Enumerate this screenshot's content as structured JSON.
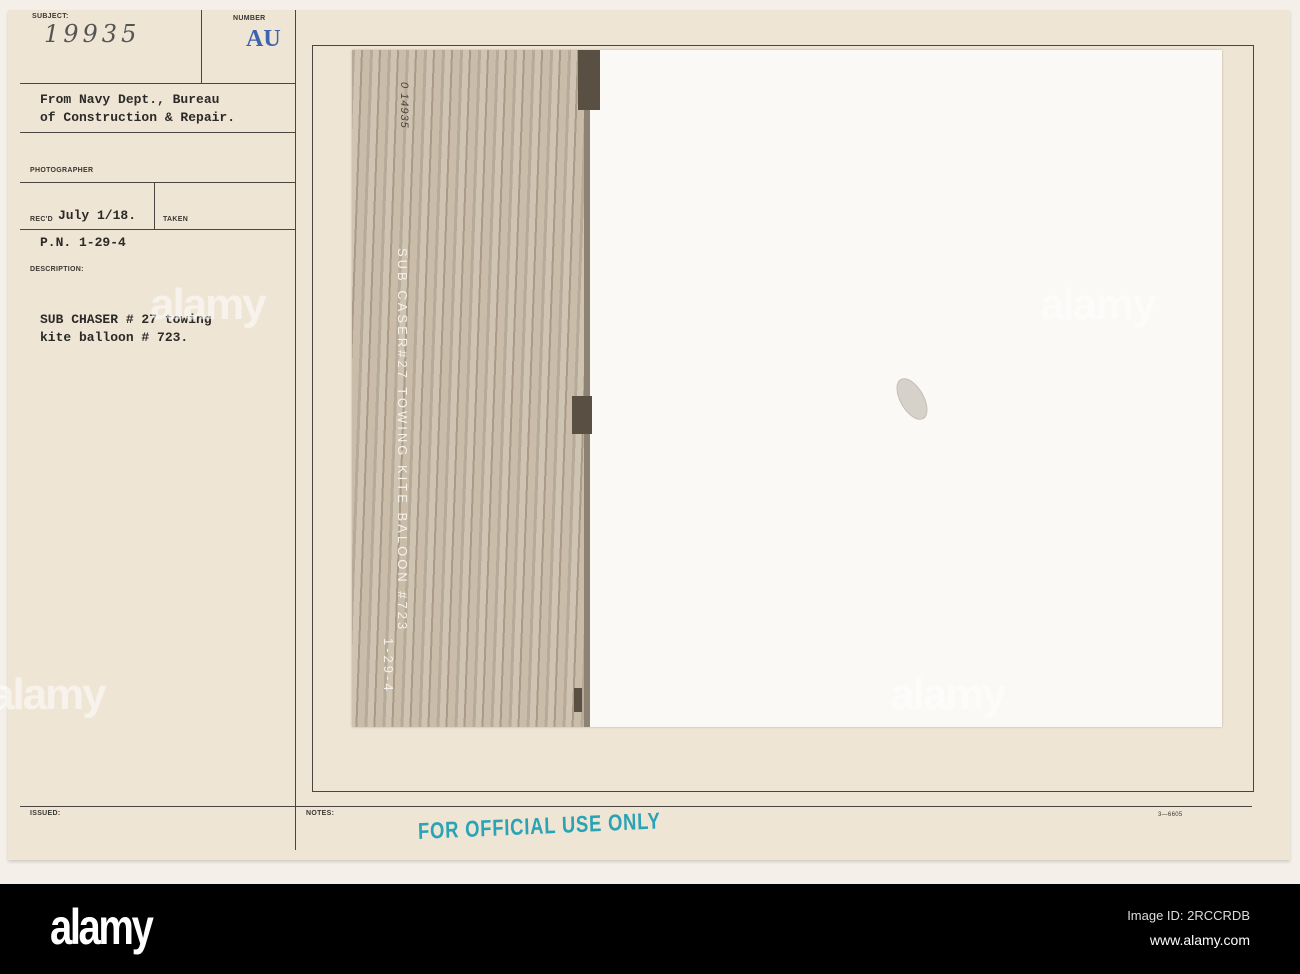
{
  "card": {
    "subject_label": "SUBJECT:",
    "subject_value": "19935",
    "number_label": "NUMBER",
    "number_value": "AU",
    "source_line1": "From Navy Dept., Bureau",
    "source_line2": "of Construction & Repair.",
    "photographer_label": "PHOTOGRAPHER",
    "recd_label": "REC'D",
    "recd_value": "July 1/18.",
    "taken_label": "TAKEN",
    "pn": "P.N. 1-29-4",
    "description_label": "DESCRIPTION:",
    "description_line1": "SUB CHASER # 27 towing",
    "description_line2": "kite balloon # 723.",
    "issued_label": "ISSUED:",
    "notes_label": "NOTES:",
    "form_number": "3—6605",
    "stamp": "FOR OFFICIAL USE ONLY"
  },
  "photo": {
    "negative_number": "0 14935",
    "caption": "SUB CASER#27 TOWING KITE BALOON #723",
    "caption_date": "1-29-4"
  },
  "watermark": "alamy",
  "footer": {
    "logo": "alamy",
    "image_id": "Image ID: 2RCCRDB",
    "url": "www.alamy.com"
  }
}
